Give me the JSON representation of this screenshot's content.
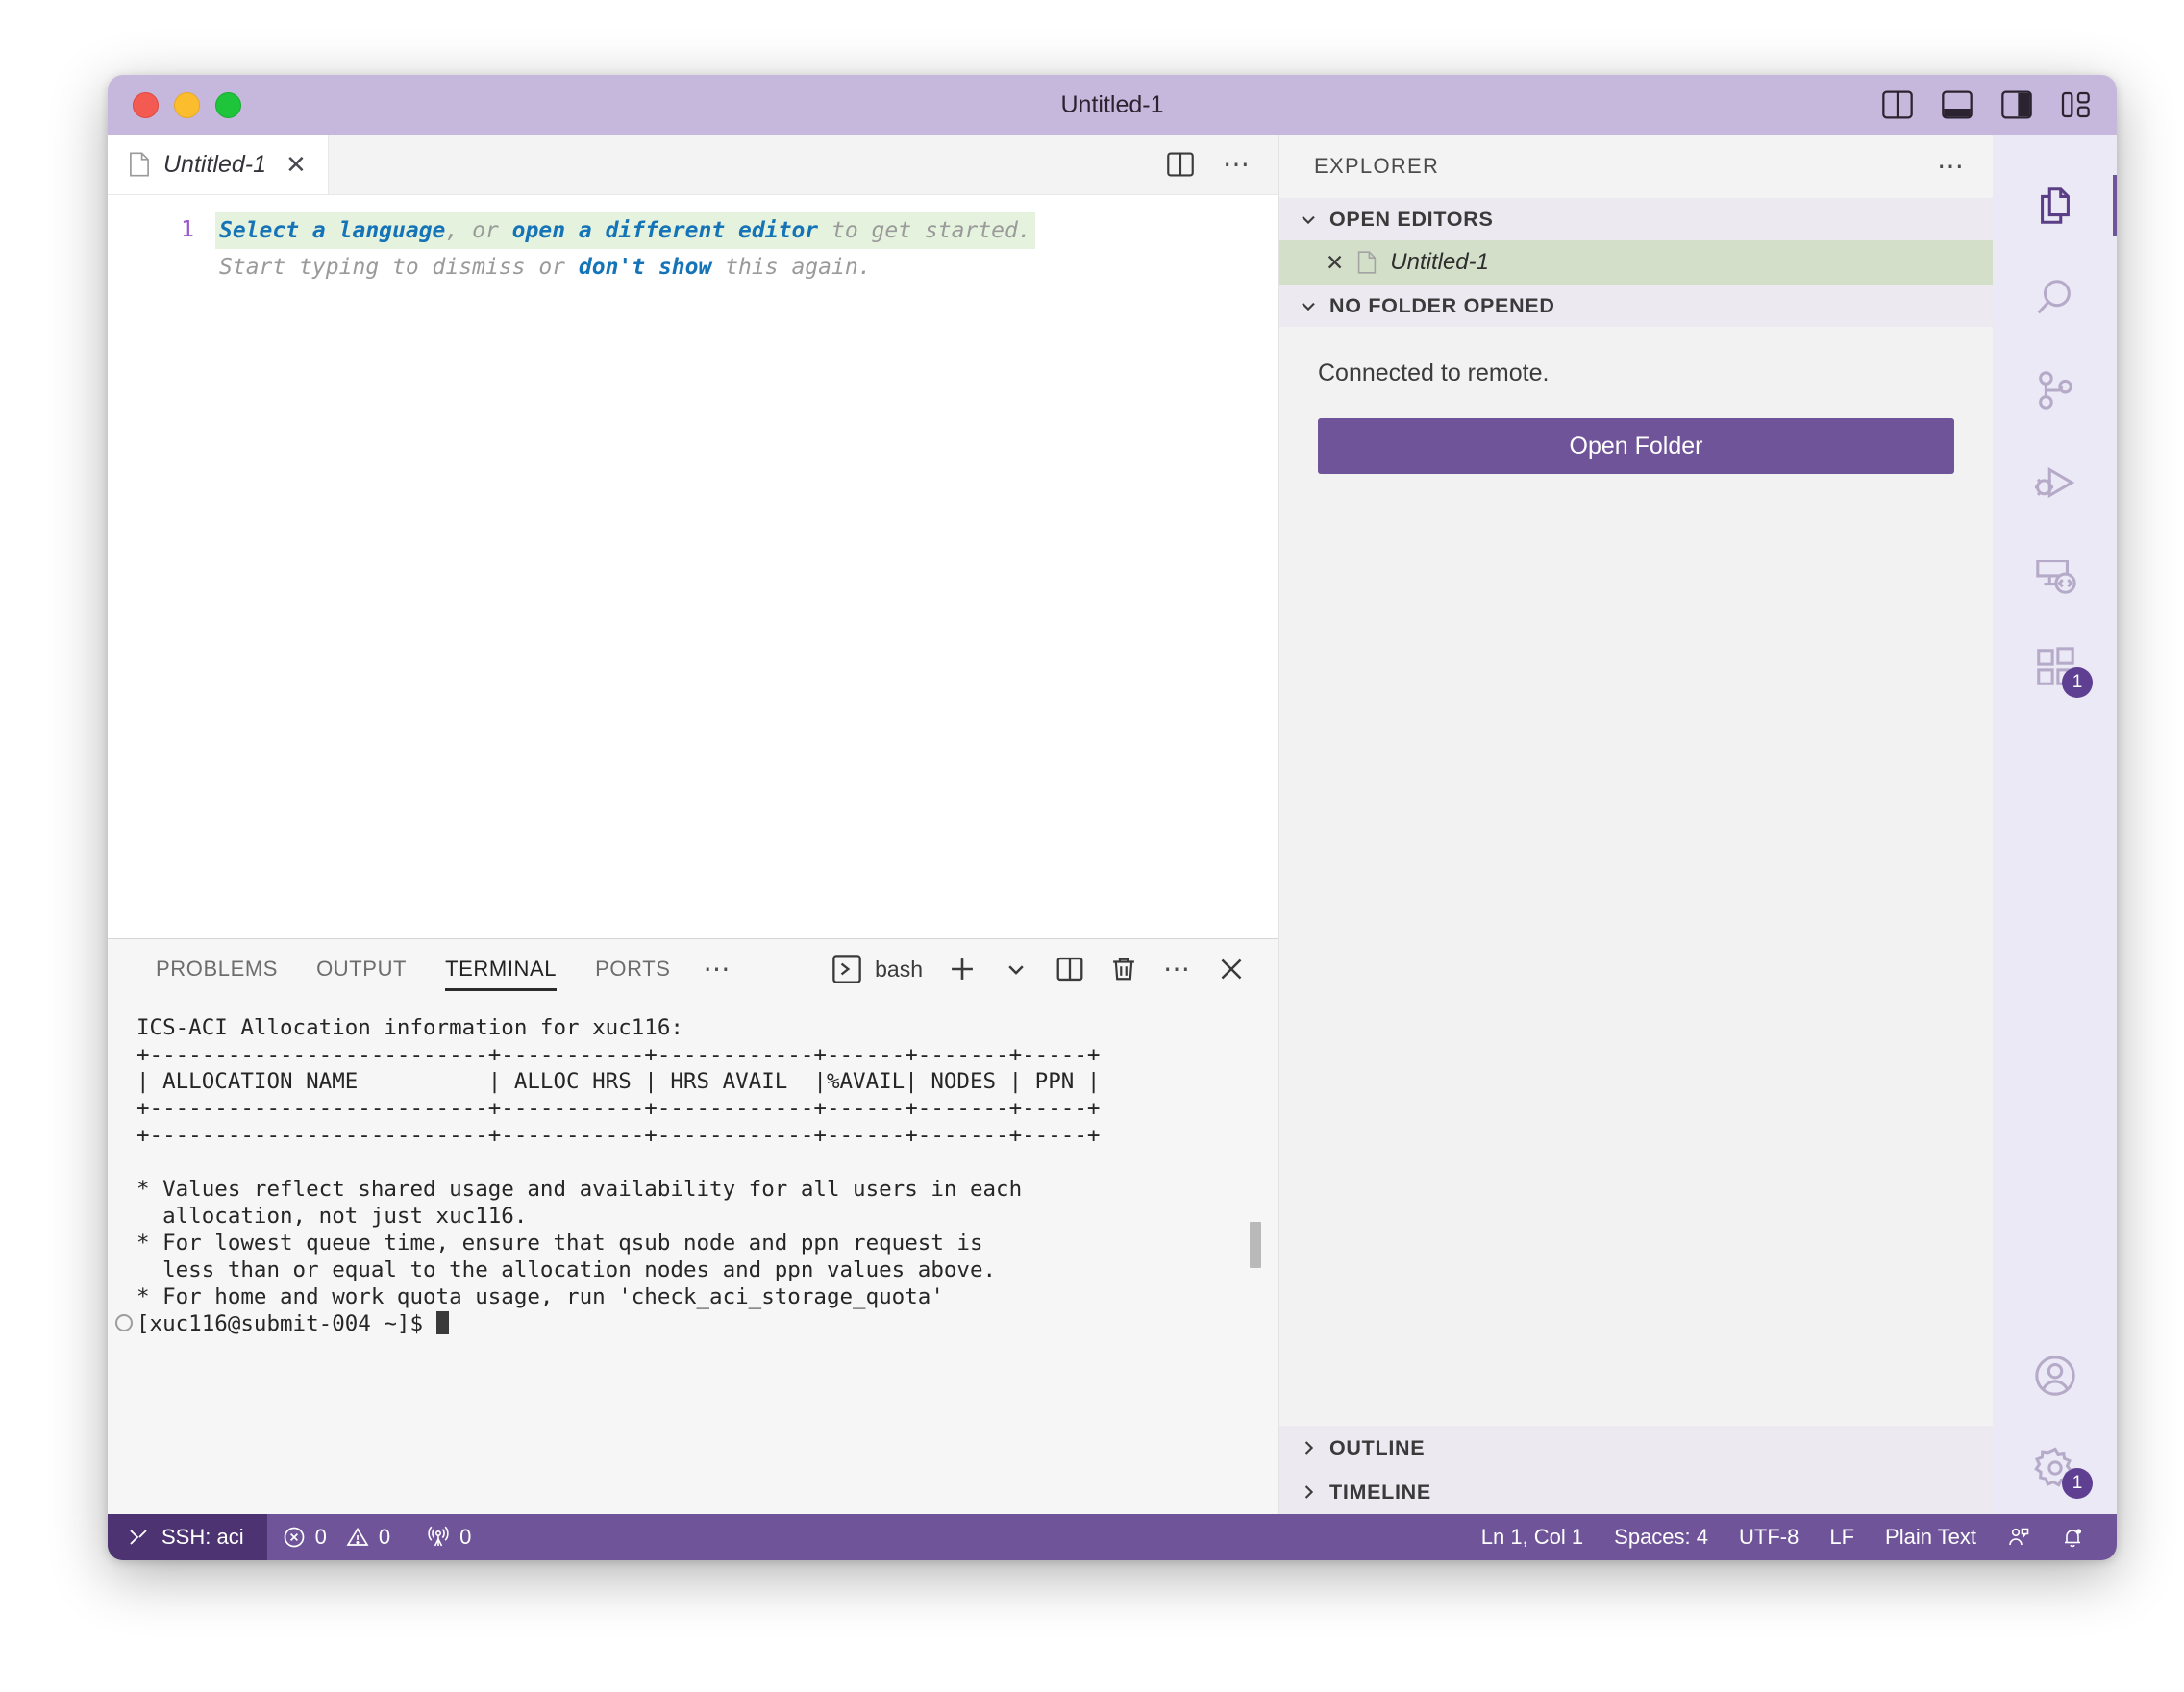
{
  "window": {
    "title": "Untitled-1",
    "traffic_lights": [
      "close",
      "minimize",
      "maximize"
    ],
    "layout_toggles": [
      "toggle-primary-sidebar",
      "toggle-panel",
      "toggle-secondary-sidebar",
      "customize-layout"
    ]
  },
  "editor": {
    "tab": {
      "label": "Untitled-1",
      "close": "✕",
      "icon": "file-icon"
    },
    "actions": [
      "split-editor-icon",
      "more-actions-icon"
    ],
    "line_number": "1",
    "ghost_line1": [
      {
        "text": "Select a language",
        "style": "link"
      },
      {
        "text": ", or ",
        "style": "dim"
      },
      {
        "text": "open a different editor",
        "style": "link"
      },
      {
        "text": " to get started.",
        "style": "dim"
      }
    ],
    "ghost_line2": [
      {
        "text": "Start typing to dismiss or ",
        "style": "dim"
      },
      {
        "text": "don't show",
        "style": "link"
      },
      {
        "text": " this again.",
        "style": "dim"
      }
    ]
  },
  "panel": {
    "tabs": [
      {
        "label": "PROBLEMS",
        "active": false
      },
      {
        "label": "OUTPUT",
        "active": false
      },
      {
        "label": "TERMINAL",
        "active": true
      },
      {
        "label": "PORTS",
        "active": false
      }
    ],
    "more_tabs": "⋯",
    "shell_name": "bash",
    "actions": [
      "terminal-icon",
      "new-terminal-icon",
      "terminal-profile-chevron-icon",
      "split-terminal-icon",
      "kill-terminal-icon",
      "panel-more-icon",
      "close-panel-icon"
    ],
    "terminal_output": "ICS-ACI Allocation information for xuc116:\n+--------------------------+-----------+------------+------+-------+-----+\n| ALLOCATION NAME          | ALLOC HRS | HRS AVAIL  |%AVAIL| NODES | PPN |\n+--------------------------+-----------+------------+------+-------+-----+\n+--------------------------+-----------+------------+------+-------+-----+\n\n* Values reflect shared usage and availability for all users in each\n  allocation, not just xuc116.\n* For lowest queue time, ensure that qsub node and ppn request is\n  less than or equal to the allocation nodes and ppn values above.\n* For home and work quota usage, run 'check_aci_storage_quota'\n",
    "prompt": "[xuc116@submit-004 ~]$ "
  },
  "sidebar": {
    "title": "EXPLORER",
    "more_icon": "more-actions-icon",
    "sections": [
      {
        "label": "OPEN EDITORS",
        "expanded": true
      },
      {
        "label": "NO FOLDER OPENED",
        "expanded": true
      },
      {
        "label": "OUTLINE",
        "expanded": false
      },
      {
        "label": "TIMELINE",
        "expanded": false
      }
    ],
    "open_editors": [
      {
        "label": "Untitled-1",
        "close": "✕",
        "selected": true
      }
    ],
    "no_folder": {
      "message": "Connected to remote.",
      "button_label": "Open Folder"
    }
  },
  "activitybar": {
    "items": [
      {
        "name": "explorer",
        "icon": "files-icon",
        "active": true,
        "badge": null
      },
      {
        "name": "search",
        "icon": "search-icon",
        "active": false,
        "badge": null
      },
      {
        "name": "source-control",
        "icon": "source-control-icon",
        "active": false,
        "badge": null
      },
      {
        "name": "run-and-debug",
        "icon": "run-debug-icon",
        "active": false,
        "badge": null
      },
      {
        "name": "remote-explorer",
        "icon": "remote-explorer-icon",
        "active": false,
        "badge": null
      },
      {
        "name": "extensions",
        "icon": "extensions-icon",
        "active": false,
        "badge": "1"
      }
    ],
    "bottom_items": [
      {
        "name": "accounts",
        "icon": "account-icon",
        "badge": null
      },
      {
        "name": "manage",
        "icon": "gear-icon",
        "badge": "1"
      }
    ]
  },
  "statusbar": {
    "remote": {
      "label": "SSH: aci",
      "icon": "remote-indicator-icon"
    },
    "problems": {
      "errors": "0",
      "warnings": "0",
      "error_icon": "error-circle-icon",
      "warning_icon": "warning-triangle-icon"
    },
    "ports": {
      "count": "0",
      "icon": "radio-tower-icon"
    },
    "right_items": [
      {
        "name": "cursor-position",
        "label": "Ln 1, Col 1"
      },
      {
        "name": "indentation",
        "label": "Spaces: 4"
      },
      {
        "name": "encoding",
        "label": "UTF-8"
      },
      {
        "name": "eol",
        "label": "LF"
      },
      {
        "name": "language-mode",
        "label": "Plain Text"
      }
    ],
    "right_icons": [
      "feedback-icon",
      "notifications-bell-icon"
    ]
  },
  "colors": {
    "titlebar": "#c6b8dc",
    "accent": "#6f5499",
    "accent_dark": "#4d3372",
    "sidebar": "#ece9f1",
    "activitybar": "#ece9f6",
    "selection_green": "#d3dfc9",
    "ghost_highlight": "#e5f2dd",
    "link_blue": "#1573b8",
    "line_number": "#9b59c9"
  }
}
